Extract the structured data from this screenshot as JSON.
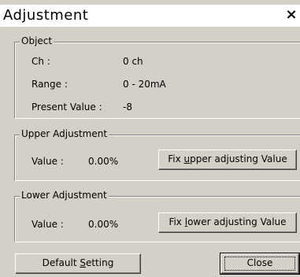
{
  "window": {
    "title": "Adjustment",
    "close_glyph": "×"
  },
  "object_group": {
    "legend": "Object",
    "rows": [
      {
        "label": "Ch :",
        "value": "0 ch"
      },
      {
        "label": "Range :",
        "value": "0 - 20mA"
      },
      {
        "label": "Present Value :",
        "value": "-8"
      }
    ]
  },
  "upper_group": {
    "legend": "Upper Adjustment",
    "value_label": "Value :",
    "value": "0.00%",
    "button": {
      "pre": "Fix ",
      "accel": "u",
      "post": "pper adjusting Value"
    }
  },
  "lower_group": {
    "legend": "Lower Adjustment",
    "value_label": "Value :",
    "value": "0.00%",
    "button": {
      "pre": "Fix ",
      "accel": "l",
      "post": "ower adjusting Value"
    }
  },
  "footer": {
    "default_button": {
      "pre": "Default ",
      "accel": "S",
      "post": "etting"
    },
    "close_button": "Close"
  }
}
